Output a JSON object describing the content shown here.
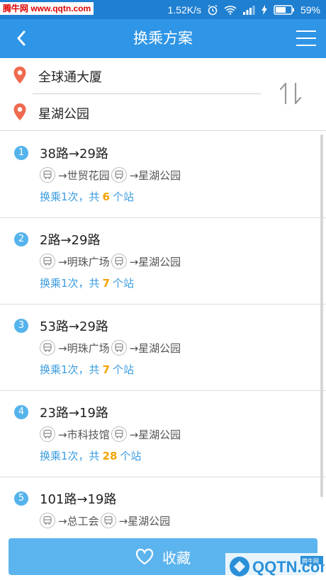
{
  "status_bar": {
    "watermark": "腾牛网 www.qqtn.com",
    "network_speed": "1.52K/s",
    "battery": "59%"
  },
  "header": {
    "title": "换乘方案"
  },
  "route": {
    "origin": "全球通大厦",
    "destination": "星湖公园"
  },
  "plans": [
    {
      "index": "1",
      "title": "38路→29路",
      "stops": [
        "→世贸花园",
        "→星湖公园"
      ],
      "summary_prefix": "换乘1次，共",
      "station_count": "6",
      "summary_suffix": "个站"
    },
    {
      "index": "2",
      "title": "2路→29路",
      "stops": [
        "→明珠广场",
        "→星湖公园"
      ],
      "summary_prefix": "换乘1次，共",
      "station_count": "7",
      "summary_suffix": "个站"
    },
    {
      "index": "3",
      "title": "53路→29路",
      "stops": [
        "→明珠广场",
        "→星湖公园"
      ],
      "summary_prefix": "换乘1次，共",
      "station_count": "7",
      "summary_suffix": "个站"
    },
    {
      "index": "4",
      "title": "23路→19路",
      "stops": [
        "→市科技馆",
        "→星湖公园"
      ],
      "summary_prefix": "换乘1次，共",
      "station_count": "28",
      "summary_suffix": "个站"
    },
    {
      "index": "5",
      "title": "101路→19路",
      "stops": [
        "→总工会",
        "→星湖公园"
      ],
      "summary_prefix": "",
      "station_count": "",
      "summary_suffix": ""
    }
  ],
  "favorite": {
    "label": "收藏"
  },
  "watermark_bottom": {
    "text": "QQTN.com",
    "tag": "腾牛网"
  },
  "colors": {
    "header": "#2f95e6",
    "accent": "#3b9ce0",
    "count": "#f3a300",
    "pin": "#ef6a4f"
  }
}
